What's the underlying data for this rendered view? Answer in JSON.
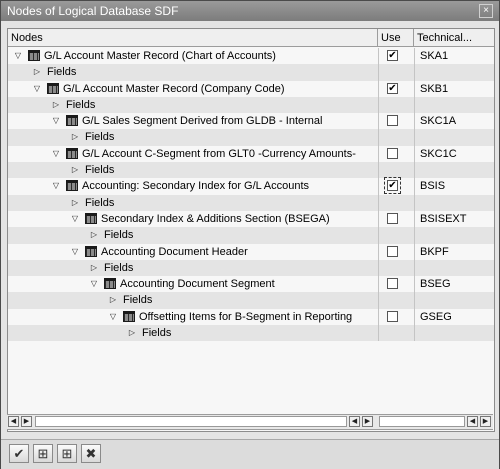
{
  "window": {
    "title": "Nodes of Logical Database SDF",
    "close_glyph": "×"
  },
  "columns": {
    "nodes": "Nodes",
    "use": "Use",
    "technical": "Technical..."
  },
  "rows": [
    {
      "level": 0,
      "kind": "node",
      "expanded": true,
      "label": "G/L Account Master Record (Chart of Accounts)",
      "use": true,
      "technical": "SKA1"
    },
    {
      "level": 1,
      "kind": "fields",
      "label": "Fields"
    },
    {
      "level": 1,
      "kind": "node",
      "expanded": true,
      "label": "G/L Account Master Record (Company Code)",
      "use": true,
      "technical": "SKB1"
    },
    {
      "level": 2,
      "kind": "fields",
      "label": "Fields"
    },
    {
      "level": 2,
      "kind": "node",
      "expanded": true,
      "label": "G/L Sales Segment Derived from GLDB - Internal",
      "use": false,
      "technical": "SKC1A"
    },
    {
      "level": 3,
      "kind": "fields",
      "label": "Fields"
    },
    {
      "level": 2,
      "kind": "node",
      "expanded": true,
      "label": "G/L Account C-Segment from GLT0 -Currency Amounts-",
      "use": false,
      "technical": "SKC1C"
    },
    {
      "level": 3,
      "kind": "fields",
      "label": "Fields"
    },
    {
      "level": 2,
      "kind": "node",
      "expanded": true,
      "label": "Accounting: Secondary Index for G/L Accounts",
      "use": true,
      "focused": true,
      "technical": "BSIS"
    },
    {
      "level": 3,
      "kind": "fields",
      "label": "Fields"
    },
    {
      "level": 3,
      "kind": "node",
      "expanded": true,
      "label": "Secondary Index & Additions Section (BSEGA)",
      "use": false,
      "technical": "BSISEXT"
    },
    {
      "level": 4,
      "kind": "fields",
      "label": "Fields"
    },
    {
      "level": 3,
      "kind": "node",
      "expanded": true,
      "label": "Accounting Document Header",
      "use": false,
      "technical": "BKPF"
    },
    {
      "level": 4,
      "kind": "fields",
      "label": "Fields"
    },
    {
      "level": 4,
      "kind": "node",
      "expanded": true,
      "label": "Accounting Document Segment",
      "use": false,
      "technical": "BSEG"
    },
    {
      "level": 5,
      "kind": "fields",
      "label": "Fields"
    },
    {
      "level": 5,
      "kind": "node",
      "expanded": true,
      "label": "Offsetting Items for B-Segment in Reporting",
      "use": false,
      "technical": "GSEG"
    },
    {
      "level": 6,
      "kind": "fields",
      "label": "Fields"
    }
  ],
  "toolbar": {
    "buttons": [
      {
        "name": "confirm-button",
        "icon": "checkmark-icon",
        "glyph": "✔"
      },
      {
        "name": "find-button",
        "icon": "binoculars-icon",
        "glyph": "⊞"
      },
      {
        "name": "find-next-button",
        "icon": "binoculars-plus-icon",
        "glyph": "⊞"
      },
      {
        "name": "cancel-button",
        "icon": "cancel-icon",
        "glyph": "✖"
      }
    ]
  }
}
